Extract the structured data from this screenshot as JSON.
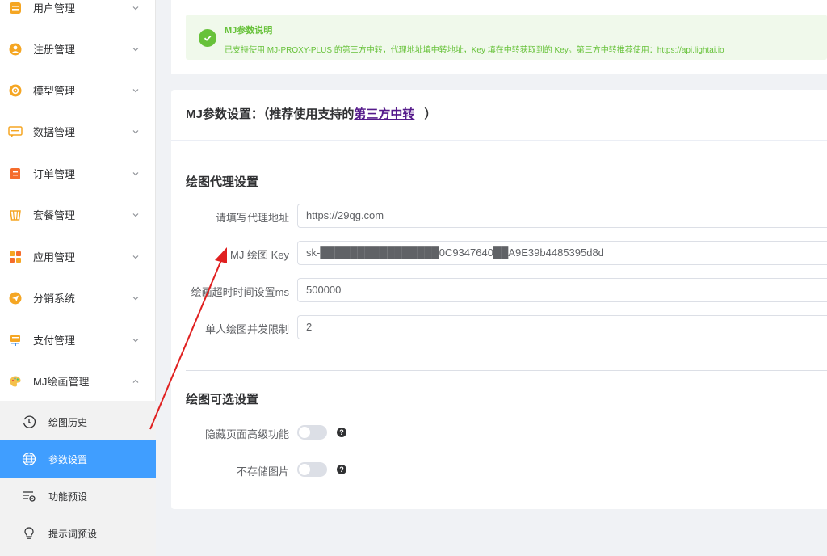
{
  "sidebar": {
    "items": [
      {
        "label": "用户管理",
        "icon": "user-card-icon"
      },
      {
        "label": "注册管理",
        "icon": "user-circle-icon"
      },
      {
        "label": "模型管理",
        "icon": "model-icon"
      },
      {
        "label": "数据管理",
        "icon": "chat-data-icon"
      },
      {
        "label": "订单管理",
        "icon": "order-icon"
      },
      {
        "label": "套餐管理",
        "icon": "package-icon"
      },
      {
        "label": "应用管理",
        "icon": "apps-icon"
      },
      {
        "label": "分销系统",
        "icon": "send-icon"
      },
      {
        "label": "支付管理",
        "icon": "payment-icon"
      },
      {
        "label": "MJ绘画管理",
        "icon": "palette-icon"
      }
    ],
    "subitems": [
      {
        "label": "绘图历史",
        "icon": "history-icon"
      },
      {
        "label": "参数设置",
        "icon": "globe-icon"
      },
      {
        "label": "功能预设",
        "icon": "preset-icon"
      },
      {
        "label": "提示词预设",
        "icon": "bulb-icon"
      }
    ]
  },
  "alert": {
    "title": "MJ参数说明",
    "desc": "已支持使用 MJ-PROXY-PLUS 的第三方中转，代理地址填中转地址，Key 填在中转获取到的 Key。第三方中转推荐使用：https://api.lightai.io"
  },
  "card": {
    "title_prefix": "MJ参数设置：（推荐使用支持的",
    "title_link": "第三方中转",
    "title_suffix": "）"
  },
  "proxy_section": {
    "title": "绘图代理设置",
    "fields": [
      {
        "label": "请填写代理地址",
        "value": "https://29qg.com"
      },
      {
        "label": "MJ 绘图 Key",
        "value": "sk-████████████████0C9347640██A9E39b4485395d8d"
      },
      {
        "label": "绘画超时时间设置ms",
        "value": "500000"
      },
      {
        "label": "单人绘图并发限制",
        "value": "2"
      }
    ]
  },
  "optional_section": {
    "title": "绘图可选设置",
    "switches": [
      {
        "label": "隐藏页面高级功能",
        "on": false
      },
      {
        "label": "不存储图片",
        "on": false
      }
    ]
  },
  "colors": {
    "primary": "#409eff",
    "success": "#67c23a",
    "annotation_arrow": "#e02020"
  }
}
